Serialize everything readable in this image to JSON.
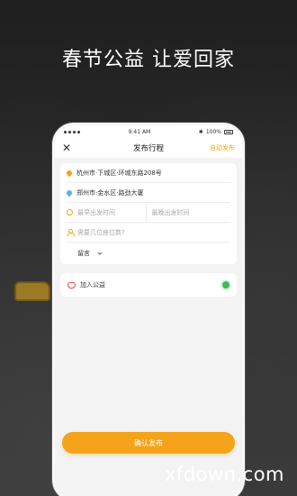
{
  "headline": "春节公益 让爱回家",
  "status": {
    "time": "9:41 AM",
    "battery": "100%"
  },
  "nav": {
    "title": "发布行程",
    "action": "自动发布"
  },
  "form": {
    "origin": "杭州市·下城区·环城东路208号",
    "destination": "郑州市·金水区·路劲大厦",
    "earliest_placeholder": "最早出发时间",
    "latest_placeholder": "最晚出发时间",
    "seats_placeholder": "需要几位座位数?",
    "message_label": "留言"
  },
  "charity": {
    "label": "加入公益",
    "enabled": true
  },
  "confirm_label": "确认发布",
  "watermark": "xfdown.com",
  "colors": {
    "accent": "#f5a31a",
    "toggle": "#3dbb5c"
  }
}
